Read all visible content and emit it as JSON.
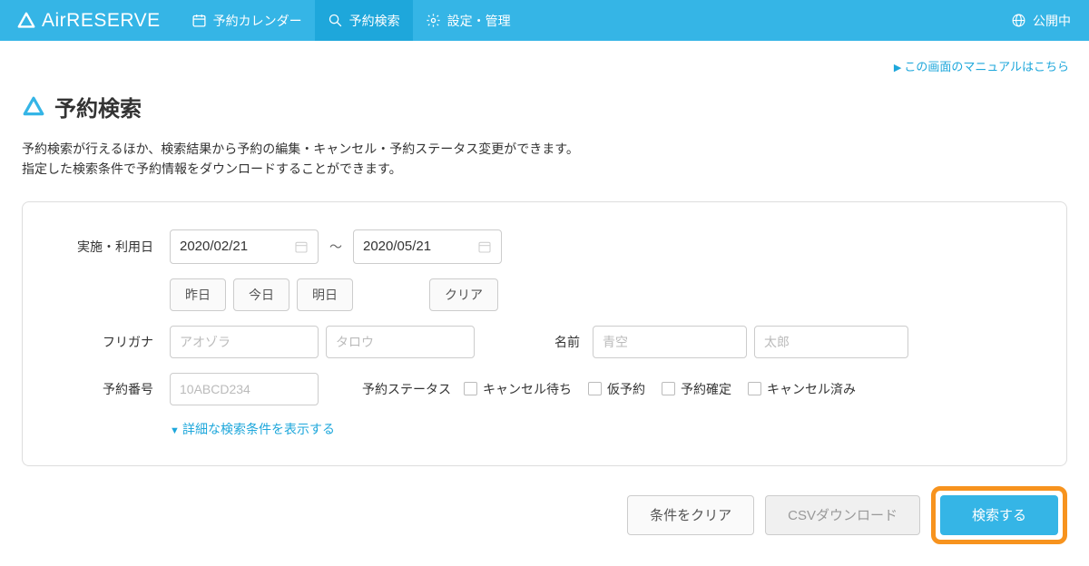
{
  "header": {
    "logo_text": "AirRESERVE",
    "nav": [
      {
        "label": "予約カレンダー",
        "icon": "calendar"
      },
      {
        "label": "予約検索",
        "icon": "search",
        "active": true
      },
      {
        "label": "設定・管理",
        "icon": "gear"
      }
    ],
    "status_label": "公開中"
  },
  "manual_link": "この画面のマニュアルはこちら",
  "page": {
    "title": "予約検索",
    "desc_line1": "予約検索が行えるほか、検索結果から予約の編集・キャンセル・予約ステータス変更ができます。",
    "desc_line2": "指定した検索条件で予約情報をダウンロードすることができます。"
  },
  "form": {
    "date_label": "実施・利用日",
    "date_from": "2020/02/21",
    "date_to": "2020/05/21",
    "quick": {
      "yesterday": "昨日",
      "today": "今日",
      "tomorrow": "明日",
      "clear": "クリア"
    },
    "furigana_label": "フリガナ",
    "furigana_sei_ph": "アオゾラ",
    "furigana_mei_ph": "タロウ",
    "name_label": "名前",
    "name_sei_ph": "青空",
    "name_mei_ph": "太郎",
    "resno_label": "予約番号",
    "resno_ph": "10ABCD234",
    "status_label": "予約ステータス",
    "statuses": [
      "キャンセル待ち",
      "仮予約",
      "予約確定",
      "キャンセル済み"
    ],
    "advanced": "詳細な検索条件を表示する"
  },
  "buttons": {
    "clear": "条件をクリア",
    "csv": "CSVダウンロード",
    "search": "検索する"
  }
}
